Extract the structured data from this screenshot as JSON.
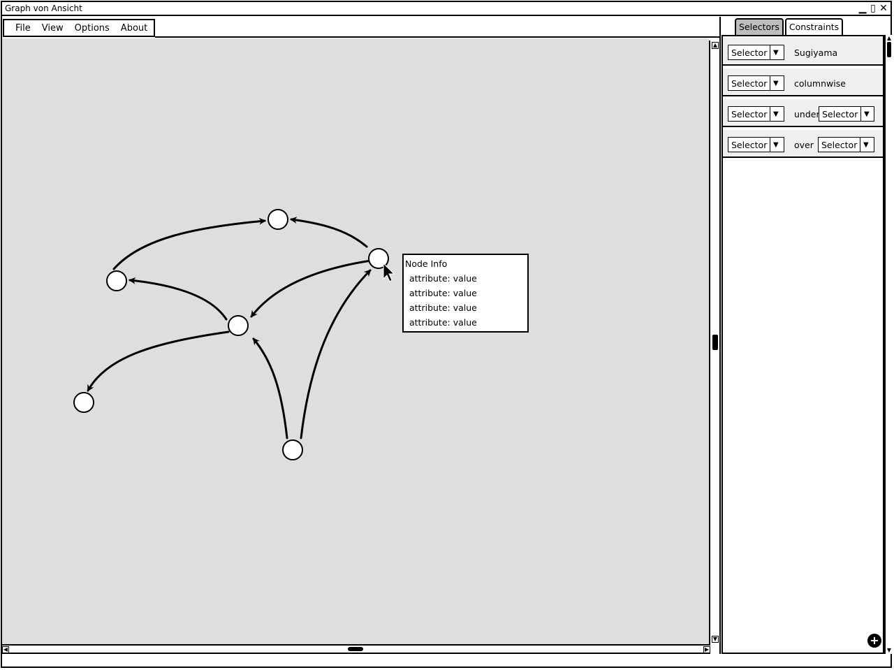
{
  "window": {
    "title": "Graph von Ansicht",
    "controls": [
      "minimize-icon",
      "maximize-icon",
      "close-icon"
    ]
  },
  "menu": {
    "items": [
      "File",
      "View",
      "Options",
      "About"
    ]
  },
  "tabs": [
    {
      "label": "Selectors",
      "active": true
    },
    {
      "label": "Constraints",
      "active": false
    }
  ],
  "constraints": [
    {
      "selector": "Selector",
      "text": "Sugiyama",
      "second_selector": null
    },
    {
      "selector": "Selector",
      "text": "columnwise",
      "second_selector": null
    },
    {
      "selector": "Selector",
      "text": "under",
      "second_selector": "Selector"
    },
    {
      "selector": "Selector",
      "text": "over",
      "second_selector": "Selector"
    }
  ],
  "tooltip": {
    "title": "Node Info",
    "attributes": [
      "attribute: value",
      "attribute: value",
      "attribute: value",
      "attribute: value"
    ]
  },
  "graph": {
    "node_count": 6,
    "edge_count": 7
  },
  "colors": {
    "canvas": "#dedede",
    "active_tab": "#bdbdbd",
    "row_bg": "#efefef"
  }
}
